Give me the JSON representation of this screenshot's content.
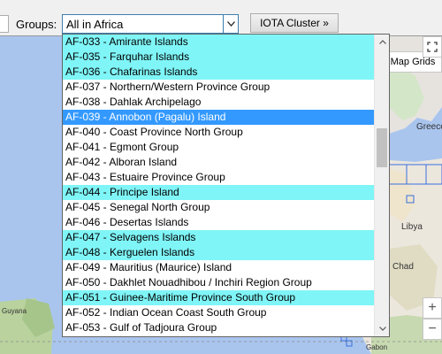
{
  "toolbar": {
    "groups_label": "Groups:",
    "groups_value": "All in Africa",
    "iota_cluster_label": "IOTA Cluster »"
  },
  "map": {
    "map_grids_label": "Map Grids",
    "labels": {
      "greece": "Greece",
      "libya": "Libya",
      "chad": "Chad",
      "guyana": "Guyana",
      "gabon": "Gabon"
    },
    "zoom_in": "+",
    "zoom_out": "−"
  },
  "dropdown": {
    "items": [
      {
        "text": "AF-033 - Amirante Islands",
        "style": "cyan"
      },
      {
        "text": "AF-035 - Farquhar Islands",
        "style": "cyan"
      },
      {
        "text": "AF-036 - Chafarinas Islands",
        "style": "cyan"
      },
      {
        "text": "AF-037 - Northern/Western Province Group",
        "style": "plain"
      },
      {
        "text": "AF-038 - Dahlak Archipelago",
        "style": "plain"
      },
      {
        "text": "AF-039 - Annobon (Pagalu) Island",
        "style": "selected"
      },
      {
        "text": "AF-040 - Coast Province North Group",
        "style": "plain"
      },
      {
        "text": "AF-041 - Egmont Group",
        "style": "plain"
      },
      {
        "text": "AF-042 - Alboran Island",
        "style": "plain"
      },
      {
        "text": "AF-043 - Estuaire Province Group",
        "style": "plain"
      },
      {
        "text": "AF-044 - Principe Island",
        "style": "cyan"
      },
      {
        "text": "AF-045 - Senegal North Group",
        "style": "plain"
      },
      {
        "text": "AF-046 - Desertas Islands",
        "style": "plain"
      },
      {
        "text": "AF-047 - Selvagens Islands",
        "style": "cyan"
      },
      {
        "text": "AF-048 - Kerguelen Islands",
        "style": "cyan"
      },
      {
        "text": "AF-049 - Mauritius (Maurice) Island",
        "style": "plain"
      },
      {
        "text": "AF-050 - Dakhlet Nouadhibou / Inchiri Region Group",
        "style": "plain"
      },
      {
        "text": "AF-051 - Guinee-Maritime Province South Group",
        "style": "cyan"
      },
      {
        "text": "AF-052 - Indian Ocean Coast South Group",
        "style": "plain"
      },
      {
        "text": "AF-053 - Gulf of Tadjoura Group",
        "style": "plain"
      }
    ]
  }
}
